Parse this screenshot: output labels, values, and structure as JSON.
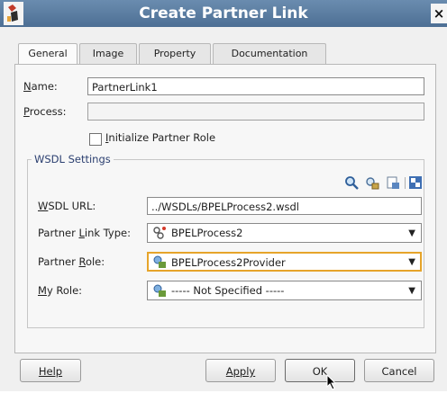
{
  "window": {
    "title": "Create Partner Link",
    "close_glyph": "×"
  },
  "tabs": [
    {
      "label": "General",
      "active": true
    },
    {
      "label": "Image",
      "active": false
    },
    {
      "label": "Property",
      "active": false
    },
    {
      "label": "Documentation",
      "active": false
    }
  ],
  "general": {
    "name_label": "Name:",
    "name_mnemonic": "N",
    "name_rest": "ame:",
    "name_value": "PartnerLink1",
    "process_label": "Process:",
    "process_mnemonic": "P",
    "process_rest": "rocess:",
    "process_value": "",
    "init_checkbox_label": "Initialize Partner Role",
    "init_mnemonic": "I",
    "init_rest": "nitialize Partner Role",
    "init_checked": false
  },
  "wsdl": {
    "legend": "WSDL Settings",
    "toolbar_icons": [
      "search-icon",
      "service-explorer-icon",
      "create-wsdl-icon",
      "converter-icon"
    ],
    "url_label": "WSDL URL:",
    "url_mnemonic": "W",
    "url_rest": "SDL URL:",
    "url_value": "../WSDLs/BPELProcess2.wsdl",
    "link_type_label_pre": "Partner ",
    "link_type_mnemonic": "L",
    "link_type_rest": "ink Type:",
    "link_type_value": "BPELProcess2",
    "partner_role_pre": "Partner ",
    "partner_role_mnemonic": "R",
    "partner_role_rest": "ole:",
    "partner_role_value": "BPELProcess2Provider",
    "my_role_mnemonic": "M",
    "my_role_rest": "y Role:",
    "my_role_value": "----- Not Specified -----"
  },
  "buttons": {
    "help": "Help",
    "apply": "Apply",
    "ok": "OK",
    "cancel": "Cancel"
  },
  "colors": {
    "titlebar": "#5a7da3",
    "focus_border": "#e6a42a"
  }
}
